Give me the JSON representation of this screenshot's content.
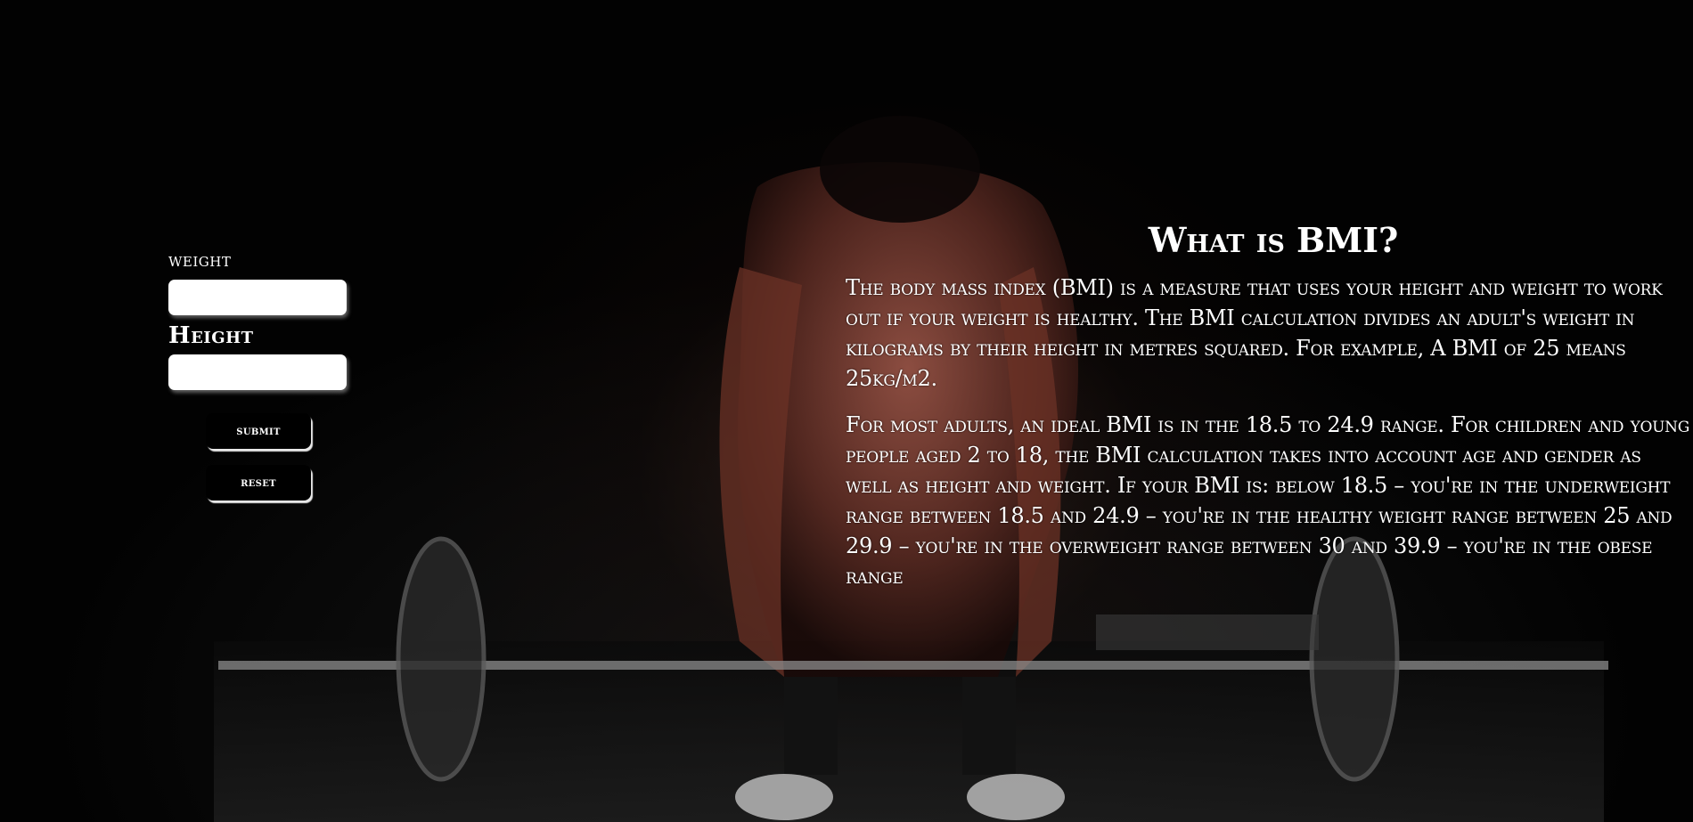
{
  "form": {
    "weight_label": "weight",
    "weight_value": "",
    "height_label": "Height",
    "height_value": "",
    "submit_label": "submit",
    "reset_label": "reset"
  },
  "info": {
    "title": "What is BMI?",
    "paragraph_1": "The body mass index (BMI) is a measure that uses your height and weight to work out if your weight is healthy. The BMI calculation divides an adult's weight in kilograms by their height in metres squared. For example, A BMI of 25 means 25kg/m2.",
    "paragraph_2": "For most adults, an ideal BMI is in the 18.5 to 24.9 range. For children and young people aged 2 to 18, the BMI calculation takes into account age and gender as well as height and weight. If your BMI is: below 18.5 – you're in the underweight range between 18.5 and 24.9 – you're in the healthy weight range between 25 and 29.9 – you're in the overweight range between 30 and 39.9 – you're in the obese range"
  }
}
